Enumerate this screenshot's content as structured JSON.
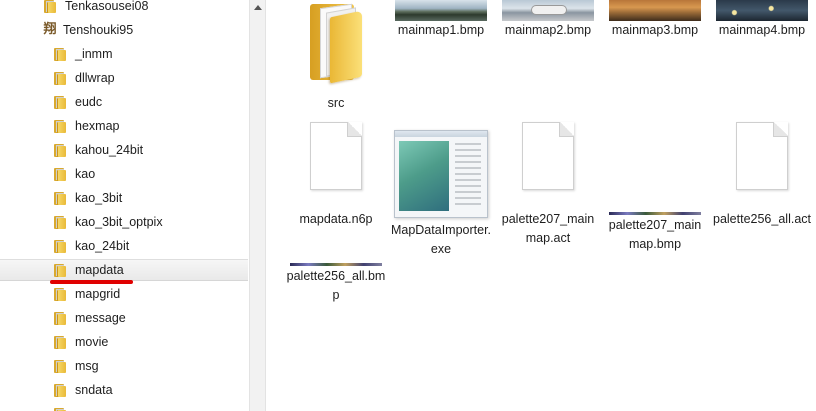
{
  "tree": {
    "items": [
      {
        "label": "Tenkasousei08",
        "icon": "folder-icon"
      },
      {
        "label": "Tenshouki95",
        "icon": "app-kanji-icon",
        "glyph": "翔"
      },
      {
        "label": "_inmm",
        "icon": "folder-icon"
      },
      {
        "label": "dllwrap",
        "icon": "folder-icon"
      },
      {
        "label": "eudc",
        "icon": "folder-icon"
      },
      {
        "label": "hexmap",
        "icon": "folder-icon"
      },
      {
        "label": "kahou_24bit",
        "icon": "folder-icon"
      },
      {
        "label": "kao",
        "icon": "folder-icon"
      },
      {
        "label": "kao_3bit",
        "icon": "folder-icon"
      },
      {
        "label": "kao_3bit_optpix",
        "icon": "folder-icon"
      },
      {
        "label": "kao_24bit",
        "icon": "folder-icon"
      },
      {
        "label": "mapdata",
        "icon": "folder-icon",
        "selected": true
      },
      {
        "label": "mapgrid",
        "icon": "folder-icon"
      },
      {
        "label": "message",
        "icon": "folder-icon"
      },
      {
        "label": "movie",
        "icon": "folder-icon"
      },
      {
        "label": "msg",
        "icon": "folder-icon"
      },
      {
        "label": "sndata",
        "icon": "folder-icon"
      }
    ]
  },
  "files": [
    {
      "name": "src",
      "type": "folder"
    },
    {
      "name": "mainmap1.bmp",
      "type": "image"
    },
    {
      "name": "mainmap2.bmp",
      "type": "image"
    },
    {
      "name": "mainmap3.bmp",
      "type": "image"
    },
    {
      "name": "mainmap4.bmp",
      "type": "image"
    },
    {
      "name": "mapdata.n6p",
      "type": "document"
    },
    {
      "name": "MapDataImporter.exe",
      "type": "executable"
    },
    {
      "name": "palette207_mainmap.act",
      "type": "document"
    },
    {
      "name": "palette207_mainmap.bmp",
      "type": "image-thin"
    },
    {
      "name": "palette256_all.act",
      "type": "document"
    },
    {
      "name": "palette256_all.bmp",
      "type": "image-thin"
    }
  ],
  "colors": {
    "highlight_mark": "#e00000",
    "folder": "#e9b938"
  }
}
